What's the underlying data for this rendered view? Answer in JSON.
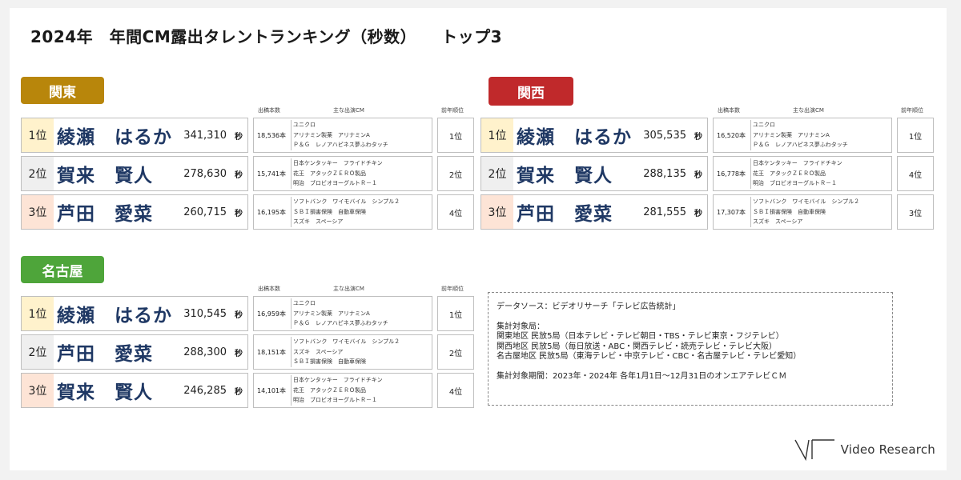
{
  "title": "2024年　年間CM露出タレントランキング（秒数）　　トップ3",
  "headers": {
    "count": "出稿本数",
    "cm": "主な出演CM",
    "prev": "前年順位"
  },
  "colors": {
    "kanto": "#b8860b",
    "kansai": "#c0292b",
    "nagoya": "#4ea53a",
    "rank1_bg": "#fff2cc",
    "rank2_bg": "#efefef",
    "rank3_bg": "#fde4d6",
    "name_color": "#1f3864"
  },
  "regions": [
    {
      "label": "関東",
      "rows": [
        {
          "rank": "1位",
          "name": "綾瀬　はるか",
          "seconds": "341,310",
          "unit": "秒",
          "count": "18,536本",
          "cms": [
            "ユニクロ",
            "アリナミン製薬　アリナミンA",
            "Ｐ＆Ｇ　レノアハピネス夢ふわタッチ"
          ],
          "prev": "1位"
        },
        {
          "rank": "2位",
          "name": "賀来　賢人",
          "seconds": "278,630",
          "unit": "秒",
          "count": "15,741本",
          "cms": [
            "日本ケンタッキー　フライドチキン",
            "花王　アタックＺＥＲＯ製品",
            "明治　ブロビオヨーグルトＲ－１"
          ],
          "prev": "2位"
        },
        {
          "rank": "3位",
          "name": "芦田　愛菜",
          "seconds": "260,715",
          "unit": "秒",
          "count": "16,195本",
          "cms": [
            "ソフトバンク　ワイモバイル　シンプル２",
            "ＳＢＩ損害保険　自動車保険",
            "スズキ　スペーシア"
          ],
          "prev": "4位"
        }
      ]
    },
    {
      "label": "関西",
      "rows": [
        {
          "rank": "1位",
          "name": "綾瀬　はるか",
          "seconds": "305,535",
          "unit": "秒",
          "count": "16,520本",
          "cms": [
            "ユニクロ",
            "アリナミン製薬　アリナミンA",
            "Ｐ＆Ｇ　レノアハピネス夢ふわタッチ"
          ],
          "prev": "1位"
        },
        {
          "rank": "2位",
          "name": "賀来　賢人",
          "seconds": "288,135",
          "unit": "秒",
          "count": "16,778本",
          "cms": [
            "日本ケンタッキー　フライドチキン",
            "花王　アタックＺＥＲＯ製品",
            "明治　ブロビオヨーグルトＲ－１"
          ],
          "prev": "4位"
        },
        {
          "rank": "3位",
          "name": "芦田　愛菜",
          "seconds": "281,555",
          "unit": "秒",
          "count": "17,307本",
          "cms": [
            "ソフトバンク　ワイモバイル　シンプル２",
            "ＳＢＩ損害保険　自動車保険",
            "スズキ　スペーシア"
          ],
          "prev": "3位"
        }
      ]
    },
    {
      "label": "名古屋",
      "rows": [
        {
          "rank": "1位",
          "name": "綾瀬　はるか",
          "seconds": "310,545",
          "unit": "秒",
          "count": "16,959本",
          "cms": [
            "ユニクロ",
            "アリナミン製薬　アリナミンA",
            "Ｐ＆Ｇ　レノアハピネス夢ふわタッチ"
          ],
          "prev": "1位"
        },
        {
          "rank": "2位",
          "name": "芦田　愛菜",
          "seconds": "288,300",
          "unit": "秒",
          "count": "18,151本",
          "cms": [
            "ソフトバンク　ワイモバイル　シンプル２",
            "スズキ　スペーシア",
            "ＳＢＩ損害保険　自動車保険"
          ],
          "prev": "2位"
        },
        {
          "rank": "3位",
          "name": "賀来　賢人",
          "seconds": "246,285",
          "unit": "秒",
          "count": "14,101本",
          "cms": [
            "日本ケンタッキー　フライドチキン",
            "花王　アタックＺＥＲＯ製品",
            "明治　ブロビオヨーグルトＲ－１"
          ],
          "prev": "4位"
        }
      ]
    }
  ],
  "note": {
    "source": "データソース：ビデオリサーチ「テレビ広告統計」",
    "target_heading": "集計対象局：",
    "kanto_stations": "関東地区 民放5局（日本テレビ・テレビ朝日・TBS・テレビ東京・フジテレビ）",
    "kansai_stations": "関西地区 民放5局（毎日放送・ABC・関西テレビ・読売テレビ・テレビ大阪）",
    "nagoya_stations": "名古屋地区 民放5局（東海テレビ・中京テレビ・CBC・名古屋テレビ・テレビ愛知）",
    "period": "集計対象期間：2023年・2024年 各年1月1日～12月31日のオンエアテレビＣＭ"
  },
  "logo": {
    "text": "Video Research"
  }
}
